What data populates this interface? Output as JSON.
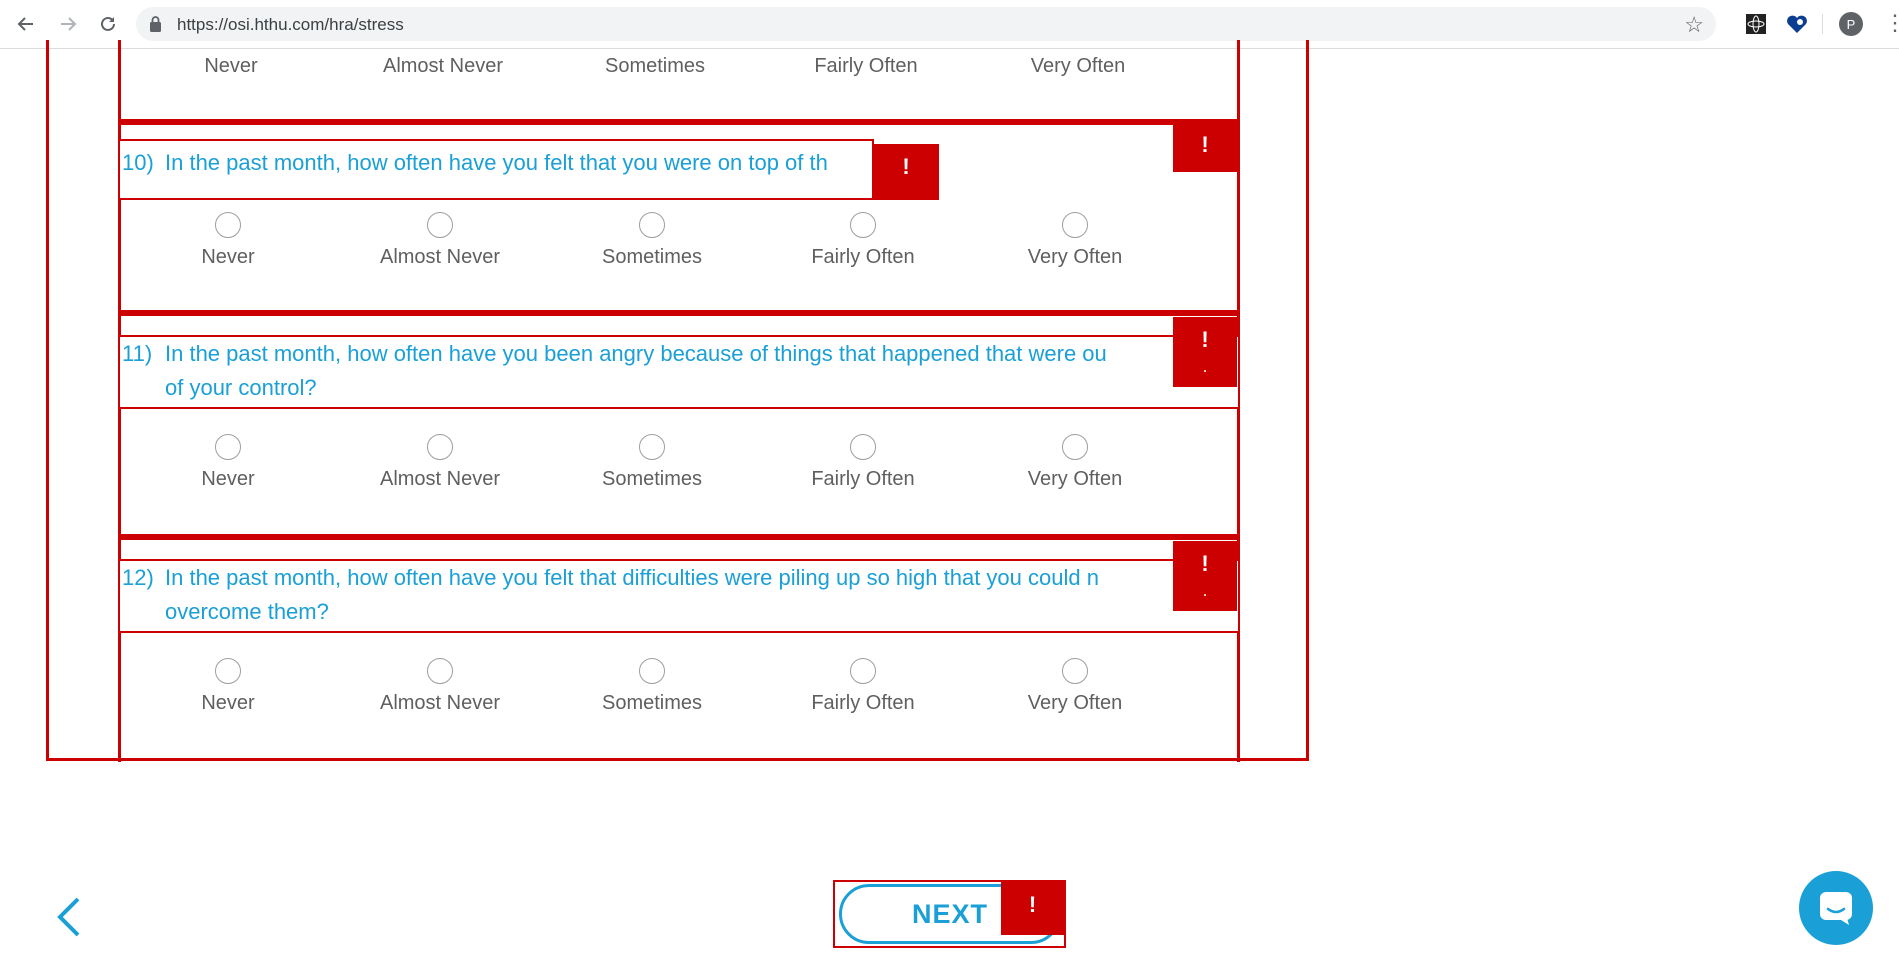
{
  "browser": {
    "url": "https://osi.hthu.com/hra/stress",
    "avatar_letter": "P"
  },
  "options": [
    "Never",
    "Almost Never",
    "Sometimes",
    "Fairly Often",
    "Very Often"
  ],
  "questions": [
    {
      "number": "10)",
      "line1": "In the past month, how often have you felt that you were on top of th",
      "line2": ""
    },
    {
      "number": "11)",
      "line1": "In the past month, how often have you been angry because of things that happened that were ou",
      "line2": "of your control?"
    },
    {
      "number": "12)",
      "line1": "In the past month, how often have you felt that difficulties were piling up so high that you could n",
      "line2": "overcome them?"
    }
  ],
  "warning_mark": "!",
  "next_button": {
    "label": "NEXT"
  },
  "colors": {
    "accent": "#1a9fd6",
    "error": "#cc0000",
    "label": "#5f5f5f"
  }
}
